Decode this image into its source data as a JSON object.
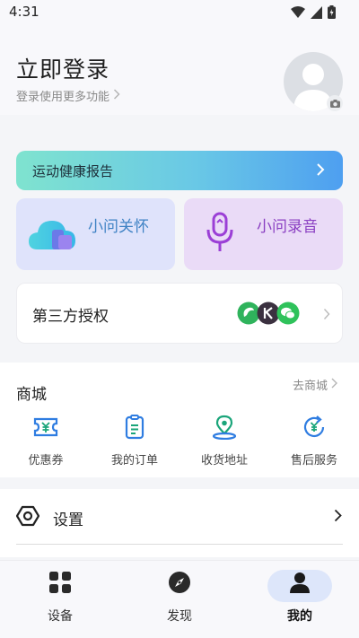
{
  "status": {
    "time": "4:31"
  },
  "profile": {
    "title": "立即登录",
    "subtitle": "登录使用更多功能"
  },
  "health": {
    "label": "运动健康报告"
  },
  "cards": {
    "care_label": "小问关怀",
    "record_label": "小问录音"
  },
  "auth": {
    "label": "第三方授权"
  },
  "shop": {
    "title": "商城",
    "link": "去商城",
    "items": [
      {
        "label": "优惠券",
        "icon": "coupon-icon"
      },
      {
        "label": "我的订单",
        "icon": "order-icon"
      },
      {
        "label": "收货地址",
        "icon": "location-icon"
      },
      {
        "label": "售后服务",
        "icon": "after-sales-icon"
      }
    ]
  },
  "settings": {
    "label": "设置"
  },
  "nav": {
    "items": [
      {
        "label": "设备",
        "icon": "device-grid-icon"
      },
      {
        "label": "发现",
        "icon": "compass-icon"
      },
      {
        "label": "我的",
        "icon": "person-icon"
      }
    ],
    "active_index": 2
  },
  "colors": {
    "accent": "#2f80ed",
    "shop_icon": "#2f7de1",
    "shop_icon_green": "#1aa57a"
  }
}
